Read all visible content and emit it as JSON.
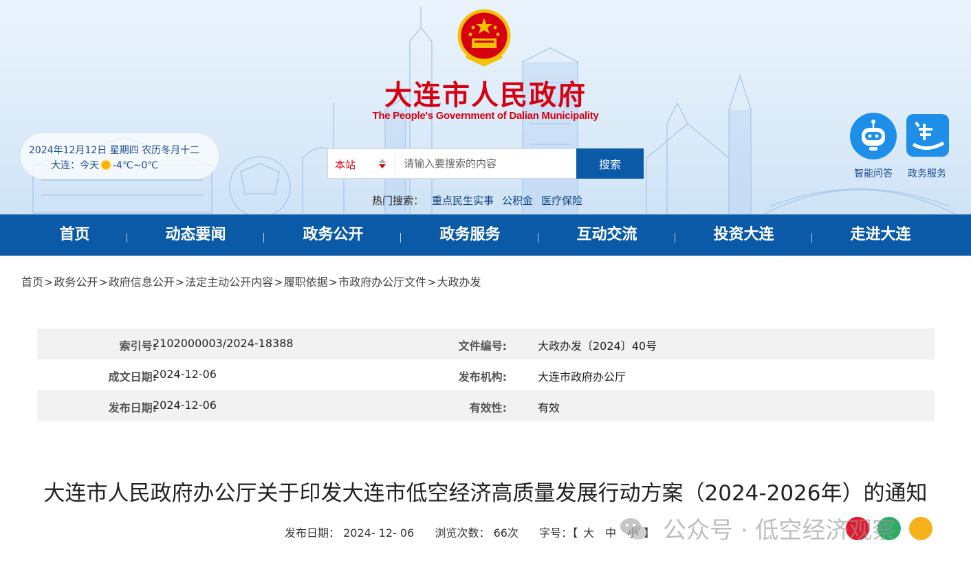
{
  "header": {
    "site_title": "大连市人民政府",
    "site_subtitle": "The People's Government of Dalian Municipality",
    "date_line": "2024年12月12日 星期四 农历冬月十二",
    "weather_city": "大连：今天",
    "weather_temp": "-4℃~0℃",
    "search": {
      "scope": "本站",
      "placeholder": "请输入要搜索的内容",
      "button": "搜索"
    },
    "hot_label": "热门搜索：",
    "hot_links": [
      "重点民生实事",
      "公积金",
      "医疗保险"
    ],
    "quick_links": [
      {
        "label": "智能问答",
        "icon": "robot-icon"
      },
      {
        "label": "政务服务",
        "icon": "lian-app-icon"
      }
    ]
  },
  "nav": {
    "items": [
      "首页",
      "动态要闻",
      "政务公开",
      "政务服务",
      "互动交流",
      "投资大连",
      "走进大连"
    ]
  },
  "breadcrumb": {
    "items": [
      "首页",
      "政务公开",
      "政府信息公开",
      "法定主动公开内容",
      "履职依据",
      "市政府办公厅文件",
      "大政办发"
    ],
    "separator": ">"
  },
  "meta": {
    "rows": [
      {
        "l1": "索引号:",
        "v1": "2102000003/2024-18388",
        "l2": "文件编号:",
        "v2": "大政办发〔2024〕40号"
      },
      {
        "l1": "成文日期:",
        "v1": "2024-12-06",
        "l2": "发布机构:",
        "v2": "大连市政府办公厅"
      },
      {
        "l1": "发布日期:",
        "v1": "2024-12-06",
        "l2": "有效性:",
        "v2": "有效"
      }
    ]
  },
  "article": {
    "title": "大连市人民政府办公厅关于印发大连市低空经济高质量发展行动方案（2024-2026年）的通知",
    "publish_label": "发布日期：",
    "publish_date": "2024- 12- 06",
    "views_label": "浏览次数：",
    "views": "66次",
    "font_label": "字号：【",
    "font_large": "大",
    "font_medium": "中",
    "font_small": "小",
    "font_end": "】"
  },
  "watermark": {
    "text": "公众号 · 低空经济观察"
  },
  "colors": {
    "brand_blue": "#0b5aa8",
    "title_red": "#d7000f",
    "row_grey": "#f2f2f2"
  }
}
